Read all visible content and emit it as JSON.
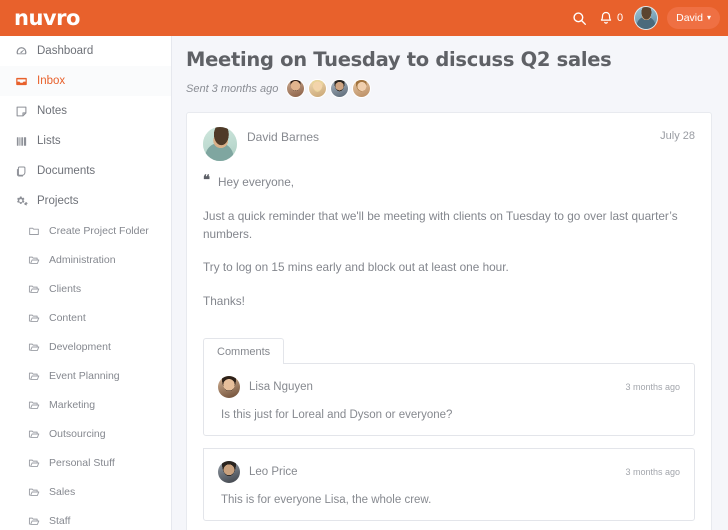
{
  "brand": {
    "name": "nuvro",
    "orange": "#e8612c",
    "pill_orange": "#ef7043"
  },
  "topbar": {
    "search_icon": "search-icon",
    "bell_icon": "bell-icon",
    "notification_count": "0",
    "user_name": "David",
    "caret": "▾"
  },
  "sidebar": {
    "items": [
      {
        "label": "Dashboard",
        "icon": "dashboard-icon",
        "active": false
      },
      {
        "label": "Inbox",
        "icon": "inbox-icon",
        "active": true
      },
      {
        "label": "Notes",
        "icon": "notes-icon",
        "active": false
      },
      {
        "label": "Lists",
        "icon": "lists-icon",
        "active": false
      },
      {
        "label": "Documents",
        "icon": "documents-icon",
        "active": false
      },
      {
        "label": "Projects",
        "icon": "projects-icon",
        "active": false
      }
    ],
    "create_folder": {
      "label": "Create Project Folder",
      "icon": "folder-closed-icon"
    },
    "folders": [
      {
        "label": "Administration",
        "icon": "folder-open-icon"
      },
      {
        "label": "Clients",
        "icon": "folder-open-icon"
      },
      {
        "label": "Content",
        "icon": "folder-open-icon"
      },
      {
        "label": "Development",
        "icon": "folder-open-icon"
      },
      {
        "label": "Event Planning",
        "icon": "folder-open-icon"
      },
      {
        "label": "Marketing",
        "icon": "folder-open-icon"
      },
      {
        "label": "Outsourcing",
        "icon": "folder-open-icon"
      },
      {
        "label": "Personal Stuff",
        "icon": "folder-open-icon"
      },
      {
        "label": "Sales",
        "icon": "folder-open-icon"
      },
      {
        "label": "Staff",
        "icon": "folder-open-icon"
      }
    ]
  },
  "page": {
    "title": "Meeting on Tuesday to discuss Q2 sales",
    "sent_label": "Sent 3 months ago",
    "participants": 4
  },
  "message": {
    "author": "David Barnes",
    "date": "July 28",
    "quote_glyph": "❝",
    "greeting": "Hey everyone,",
    "paragraphs": [
      "Just a quick reminder that we'll be meeting with clients on Tuesday to go over last quarter’s numbers.",
      "Try to log on 15 mins early and block out at least one hour.",
      "Thanks!"
    ]
  },
  "comments": {
    "tab_label": "Comments",
    "items": [
      {
        "author": "Lisa Nguyen",
        "time": "3 months ago",
        "text": "Is this just for Loreal and Dyson or everyone?"
      },
      {
        "author": "Leo Price",
        "time": "3 months ago",
        "text": "This is for everyone Lisa, the whole crew."
      }
    ]
  }
}
